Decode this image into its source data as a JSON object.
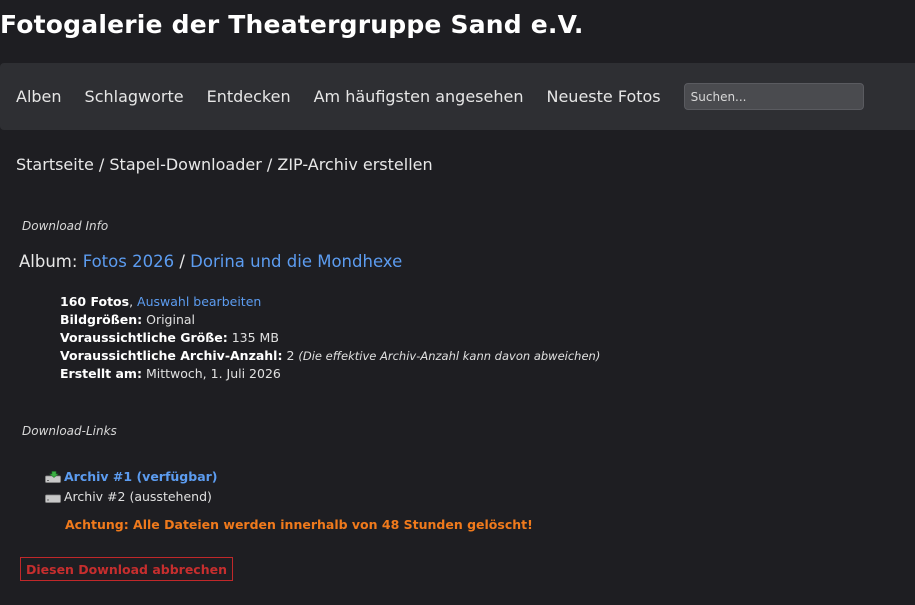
{
  "site": {
    "title": "Fotogalerie der Theatergruppe Sand e.V."
  },
  "nav": {
    "items": [
      {
        "label": "Alben"
      },
      {
        "label": "Schlagworte"
      },
      {
        "label": "Entdecken"
      },
      {
        "label": "Am häufigsten angesehen"
      },
      {
        "label": "Neueste Fotos"
      }
    ],
    "search_placeholder": "Suchen..."
  },
  "breadcrumb": "Startseite / Stapel-Downloader / ZIP-Archiv erstellen",
  "download_info": {
    "label": "Download Info",
    "album_prefix": "Album:",
    "album_parent": "Fotos 2026",
    "separator": "/",
    "album_name": "Dorina und die Mondhexe",
    "photo_count": "160 Fotos",
    "edit_selection": "Auswahl bearbeiten",
    "size_label": "Bildgrößen:",
    "size_value": "Original",
    "est_size_label": "Voraussichtliche Größe:",
    "est_size_value": "135 MB",
    "est_archives_label": "Voraussichtliche Archiv-Anzahl:",
    "est_archives_value": "2",
    "est_archives_note": "(Die effektive Archiv-Anzahl kann davon abweichen)",
    "created_label": "Erstellt am:",
    "created_value": "Mittwoch, 1. Juli 2026"
  },
  "download_links": {
    "label": "Download-Links",
    "archives": [
      {
        "label": "Archiv #1 (verfügbar)"
      },
      {
        "label": "Archiv #2 (ausstehend)"
      }
    ],
    "warning": "Achtung: Alle Dateien werden innerhalb von 48 Stunden gelöscht!",
    "cancel_label": "Diesen Download abbrechen"
  },
  "colors": {
    "background": "#1e1e22",
    "navbar": "#2e2f33",
    "link": "#5c9cf0",
    "warning": "#f07a1c",
    "cancel": "#c62e2e"
  }
}
